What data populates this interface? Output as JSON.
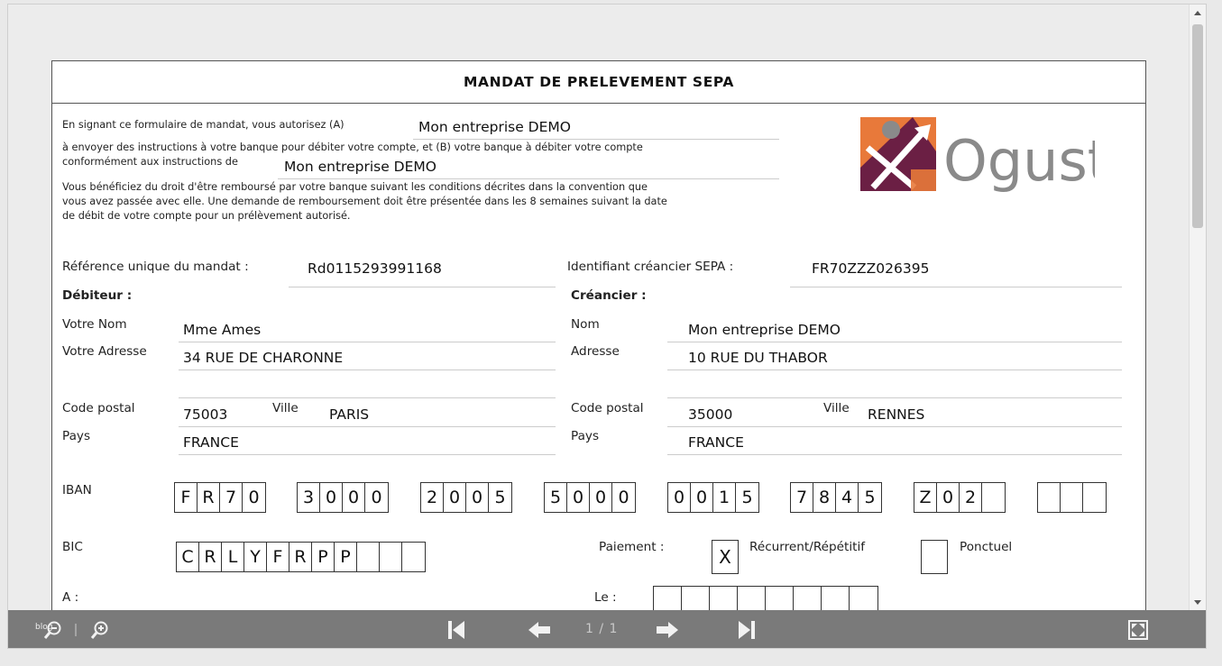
{
  "title": "MANDAT DE PRELEVEMENT SEPA",
  "intro": {
    "line1": "En signant ce formulaire de mandat, vous autorisez (A)",
    "creditor_a": "Mon entreprise DEMO",
    "line2": "à envoyer des instructions à votre banque pour débiter votre compte, et (B) votre banque à débiter votre compte",
    "line3": "conformément aux instructions de",
    "creditor_b": "Mon entreprise DEMO",
    "rights1": "Vous bénéficiez du droit d'être remboursé par votre banque suivant les conditions décrites dans la convention que",
    "rights2": "vous avez passée avec elle. Une demande de remboursement doit être présentée dans les 8 semaines suivant la date",
    "rights3": "de débit de votre compte pour un prélèvement autorisé."
  },
  "logo": {
    "text": "Ogust",
    "orange": "#e8793a",
    "purple": "#6b1f44",
    "gray": "#8a8a8a"
  },
  "reference": {
    "label": "Référence unique du mandat :",
    "value": "Rd0115293991168"
  },
  "creditor_id": {
    "label": "Identifiant créancier SEPA :",
    "value": "FR70ZZZ026395"
  },
  "debtor": {
    "heading": "Débiteur :",
    "name_label": "Votre Nom",
    "name": "Mme Ames",
    "address_label": "Votre Adresse",
    "address": "34 RUE DE CHARONNE",
    "postal_label": "Code postal",
    "postal": "75003",
    "city_label": "Ville",
    "city": "PARIS",
    "country_label": "Pays",
    "country": "FRANCE"
  },
  "creditor": {
    "heading": "Créancier :",
    "name_label": "Nom",
    "name": "Mon entreprise DEMO",
    "address_label": "Adresse",
    "address": "10 RUE DU THABOR",
    "postal_label": "Code postal",
    "postal": "35000",
    "city_label": "Ville",
    "city": "RENNES",
    "country_label": "Pays",
    "country": "FRANCE"
  },
  "iban": {
    "label": "IBAN",
    "groups": [
      [
        "F",
        "R",
        "7",
        "0"
      ],
      [
        "3",
        "0",
        "0",
        "0"
      ],
      [
        "2",
        "0",
        "0",
        "5"
      ],
      [
        "5",
        "0",
        "0",
        "0"
      ],
      [
        "0",
        "0",
        "1",
        "5"
      ],
      [
        "7",
        "8",
        "4",
        "5"
      ],
      [
        "Z",
        "0",
        "2",
        ""
      ],
      [
        "",
        "",
        ""
      ]
    ]
  },
  "bic": {
    "label": "BIC",
    "chars": [
      "C",
      "R",
      "L",
      "Y",
      "F",
      "R",
      "P",
      "P",
      "",
      "",
      ""
    ]
  },
  "payment": {
    "label": "Paiement :",
    "recurrent_mark": "X",
    "recurrent_label": "Récurrent/Répétitif",
    "oneoff_mark": "",
    "oneoff_label": "Ponctuel"
  },
  "place_label": "A :",
  "date_label": "Le :",
  "date_cells": [
    "",
    "",
    "",
    "",
    "",
    "",
    "",
    ""
  ],
  "toolbar": {
    "page": "1 / 1",
    "watermark": "blog"
  }
}
